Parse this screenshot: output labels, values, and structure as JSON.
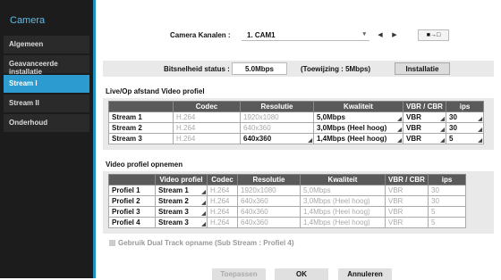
{
  "sidebar": {
    "title": "Camera",
    "items": [
      {
        "label": "Algemeen",
        "active": false
      },
      {
        "label": "Geavanceerde installatie",
        "active": false
      },
      {
        "label": "Stream I",
        "active": true
      },
      {
        "label": "Stream II",
        "active": false
      },
      {
        "label": "Onderhoud",
        "active": false
      }
    ],
    "accent_color": "#2c9bd0"
  },
  "camera_channel": {
    "label": "Camera Kanalen :",
    "value": "1. CAM1",
    "prev_icon": "triangle-left",
    "next_icon": "triangle-right",
    "copy_icon": "camera-copy-icon"
  },
  "bitrate": {
    "label": "Bitsnelheid status :",
    "value": "5.0Mbps",
    "assignment": "(Toewijzing : 5Mbps)",
    "settings_button": "Installatie"
  },
  "live_section": {
    "title": "Live/Op afstand Video profiel",
    "headers": [
      "",
      "Codec",
      "Resolutie",
      "Kwaliteit",
      "VBR / CBR",
      "ips"
    ],
    "rows": [
      {
        "name": "Stream 1",
        "codec": "H.264",
        "resolution": "1920x1080",
        "quality": "5,0Mbps",
        "vbr": "VBR",
        "fps": "30",
        "resolution_enabled": false
      },
      {
        "name": "Stream 2",
        "codec": "H.264",
        "resolution": "640x360",
        "quality": "3,0Mbps (Heel hoog)",
        "vbr": "VBR",
        "fps": "30",
        "resolution_enabled": false
      },
      {
        "name": "Stream 3",
        "codec": "H.264",
        "resolution": "640x360",
        "quality": "1,4Mbps (Heel hoog)",
        "vbr": "VBR",
        "fps": "5",
        "resolution_enabled": true
      }
    ]
  },
  "record_section": {
    "title": "Video profiel opnemen",
    "headers": [
      "",
      "Video profiel",
      "Codec",
      "Resolutie",
      "Kwaliteit",
      "VBR / CBR",
      "ips"
    ],
    "rows": [
      {
        "name": "Profiel 1",
        "profile": "Stream 1",
        "codec": "H.264",
        "resolution": "1920x1080",
        "quality": "5,0Mbps",
        "vbr": "VBR",
        "fps": "30"
      },
      {
        "name": "Profiel 2",
        "profile": "Stream 2",
        "codec": "H.264",
        "resolution": "640x360",
        "quality": "3,0Mbps (Heel hoog)",
        "vbr": "VBR",
        "fps": "30"
      },
      {
        "name": "Profiel 3",
        "profile": "Stream 3",
        "codec": "H.264",
        "resolution": "640x360",
        "quality": "1,4Mbps (Heel hoog)",
        "vbr": "VBR",
        "fps": "5"
      },
      {
        "name": "Profiel 4",
        "profile": "Stream 3",
        "codec": "H.264",
        "resolution": "640x360",
        "quality": "1,4Mbps (Heel hoog)",
        "vbr": "VBR",
        "fps": "5"
      }
    ]
  },
  "dual_track": {
    "label": "Gebruik Dual Track opname",
    "sub": "(Sub Stream : Profiel 4)",
    "checked": false
  },
  "footer": {
    "apply": "Toepassen",
    "ok": "OK",
    "cancel": "Annuleren"
  }
}
